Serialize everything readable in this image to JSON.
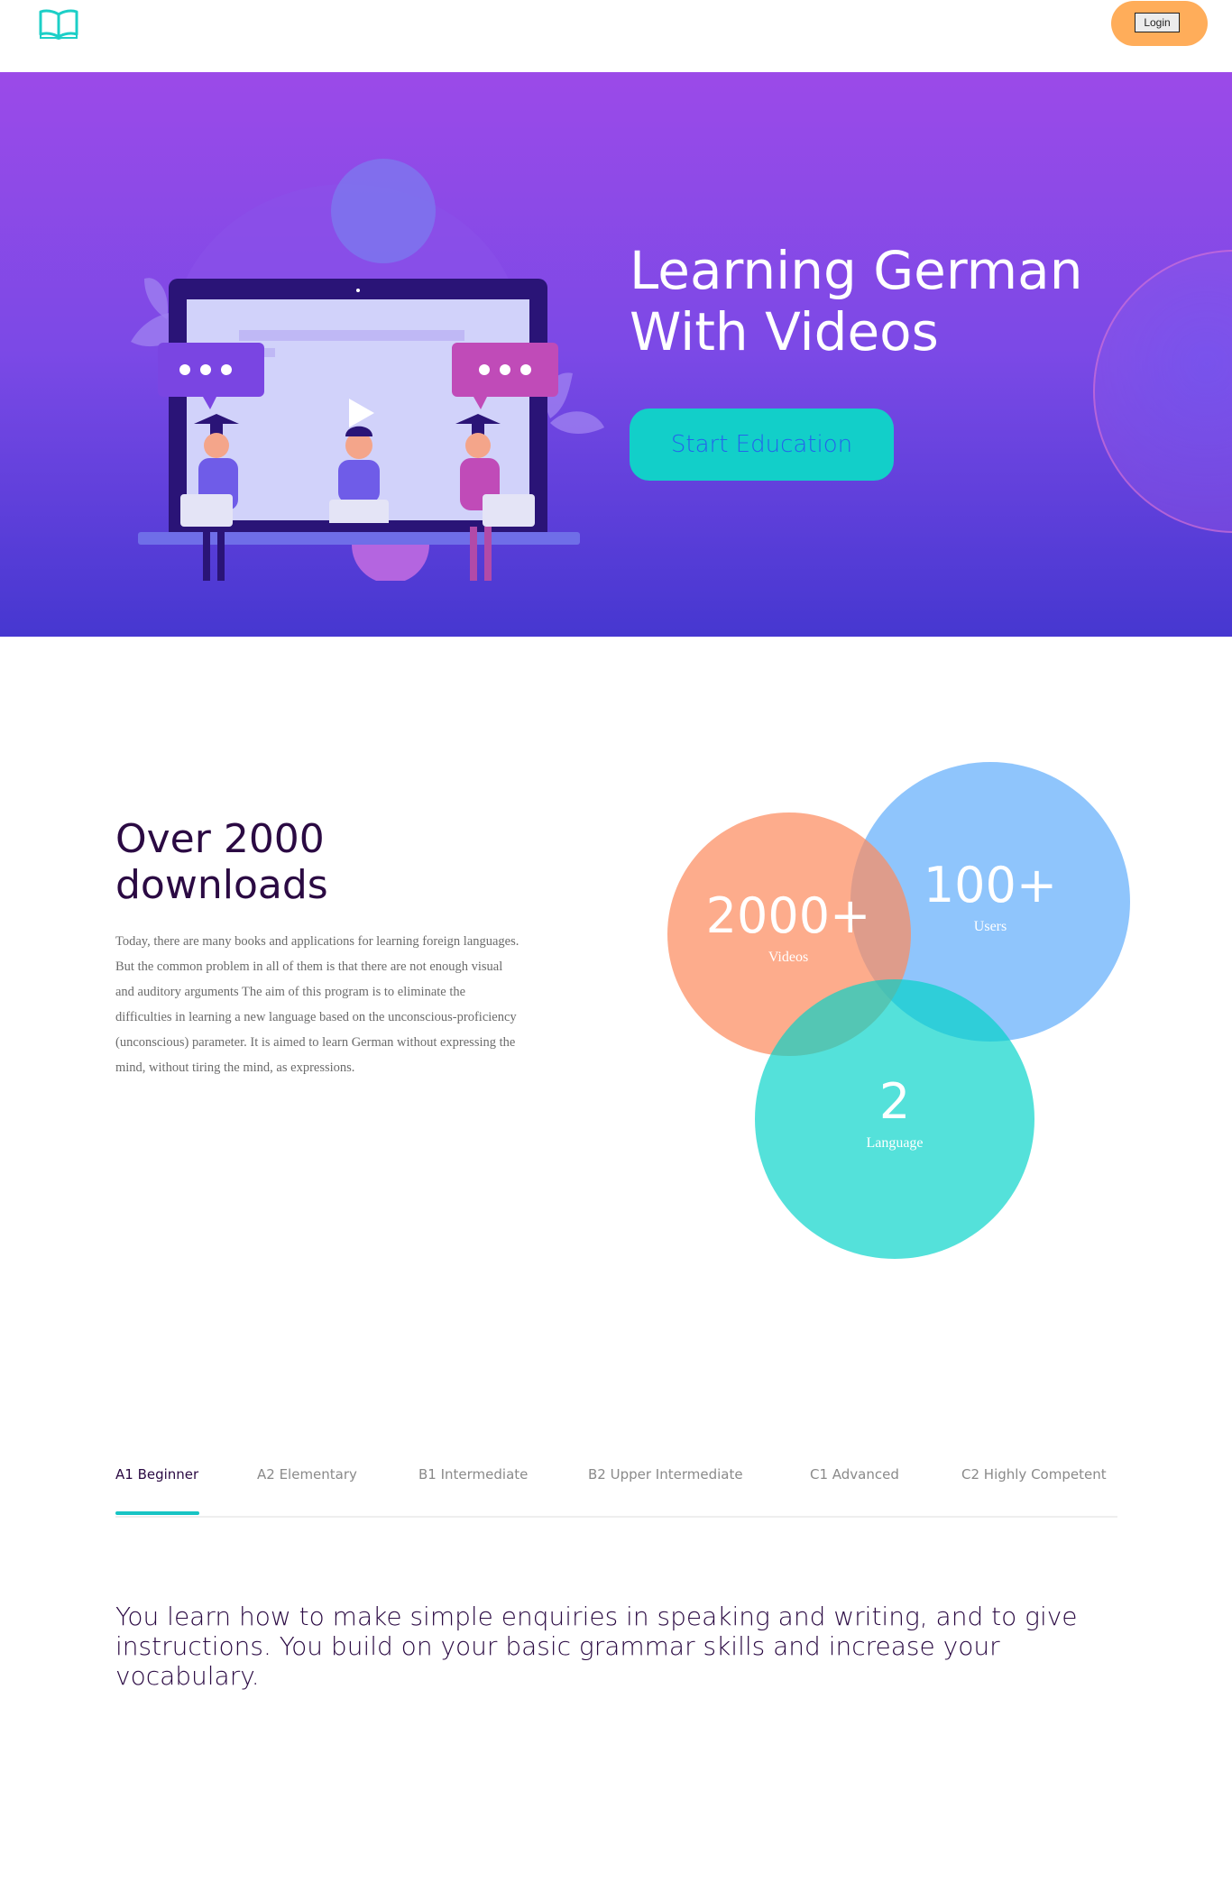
{
  "header": {
    "logo_icon": "open-book-icon",
    "login_label": "Login"
  },
  "hero": {
    "title_line1": "Learning German",
    "title_line2": "With Videos",
    "cta_label": "Start Education"
  },
  "stats": {
    "heading_line1": "Over 2000",
    "heading_line2": "downloads",
    "description": "Today, there are many books and applications for learning foreign languages. But the common problem in all of them is that there are not enough visual and auditory arguments The aim of this program is to eliminate the difficulties in learning a new language based on the unconscious-proficiency (unconscious) parameter. It is aimed to learn German without expressing the mind, without tiring the mind, as expressions.",
    "items": [
      {
        "value": "2000+",
        "label": "Videos",
        "color": "#fc8c5f"
      },
      {
        "value": "100+",
        "label": "Users",
        "color": "#5aaafa"
      },
      {
        "value": "2",
        "label": "Language",
        "color": "#00d2c8"
      }
    ]
  },
  "levels": {
    "tabs": [
      {
        "label": "A1 Beginner"
      },
      {
        "label": "A2 Elementary"
      },
      {
        "label": "B1 Intermediate"
      },
      {
        "label": "B2 Upper Intermediate"
      },
      {
        "label": "C1 Advanced"
      },
      {
        "label": "C2 Highly Competent"
      }
    ],
    "active_index": 0,
    "active_content": "You learn how to make simple enquiries in speaking and writing, and to give instructions. You build on your basic grammar skills and increase your vocabulary."
  },
  "colors": {
    "accent_teal": "#12cfc9",
    "login_orange": "#ffad5a",
    "hero_purple_top": "#9b4ae8",
    "hero_purple_bottom": "#4637d0",
    "heading_dark": "#2b0a43"
  }
}
